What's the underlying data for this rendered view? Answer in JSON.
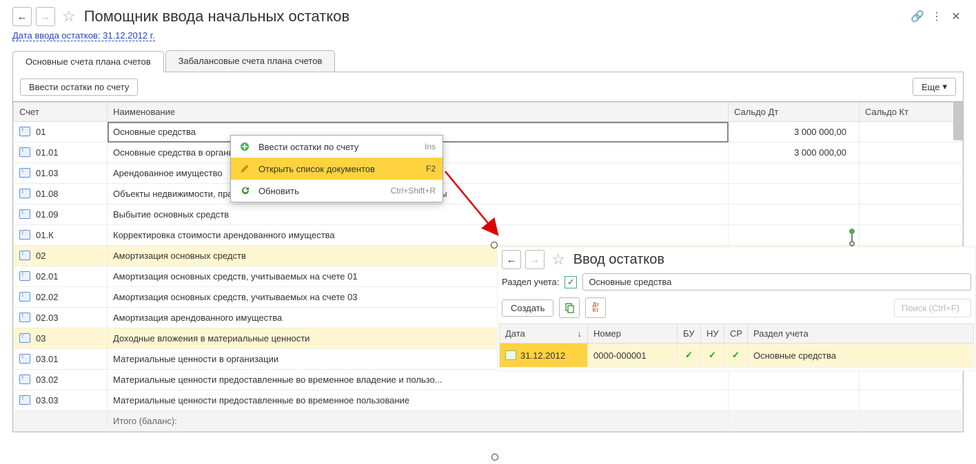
{
  "main": {
    "title": "Помощник ввода начальных остатков",
    "date_link": "Дата ввода остатков: 31.12.2012 г.",
    "tabs": [
      "Основные счета плана счетов",
      "Забалансовые счета плана счетов"
    ],
    "btn_enter": "Ввести остатки по счету",
    "btn_more": "Еще",
    "columns": {
      "c1": "Счет",
      "c2": "Наименование",
      "c3": "Сальдо Дт",
      "c4": "Сальдо Кт"
    },
    "rows": [
      {
        "acc": "01",
        "name": "Основные средства",
        "dt": "3 000 000,00",
        "kt": "",
        "hl": false,
        "sel": true
      },
      {
        "acc": "01.01",
        "name": "Основные средства в организации",
        "dt": "3 000 000,00",
        "kt": "",
        "hl": false
      },
      {
        "acc": "01.03",
        "name": "Арендованное имущество",
        "dt": "",
        "kt": "",
        "hl": false
      },
      {
        "acc": "01.08",
        "name": "Объекты недвижимости, права собственности на которые не зарегистрированы",
        "dt": "",
        "kt": "",
        "hl": false
      },
      {
        "acc": "01.09",
        "name": "Выбытие основных средств",
        "dt": "",
        "kt": "",
        "hl": false
      },
      {
        "acc": "01.К",
        "name": "Корректировка стоимости арендованного имущества",
        "dt": "",
        "kt": "",
        "hl": false
      },
      {
        "acc": "02",
        "name": "Амортизация основных средств",
        "dt": "",
        "kt": "",
        "hl": true
      },
      {
        "acc": "02.01",
        "name": "Амортизация основных средств, учитываемых на счете 01",
        "dt": "",
        "kt": "",
        "hl": false
      },
      {
        "acc": "02.02",
        "name": "Амортизация основных средств, учитываемых на счете 03",
        "dt": "",
        "kt": "",
        "hl": false
      },
      {
        "acc": "02.03",
        "name": "Амортизация арендованного имущества",
        "dt": "",
        "kt": "",
        "hl": false
      },
      {
        "acc": "03",
        "name": "Доходные вложения в материальные ценности",
        "dt": "",
        "kt": "",
        "hl": true
      },
      {
        "acc": "03.01",
        "name": "Материальные ценности в организации",
        "dt": "",
        "kt": "",
        "hl": false
      },
      {
        "acc": "03.02",
        "name": "Материальные ценности предоставленные во временное владение и пользо...",
        "dt": "",
        "kt": "",
        "hl": false
      },
      {
        "acc": "03.03",
        "name": "Материальные ценности предоставленные во временное пользование",
        "dt": "",
        "kt": "",
        "hl": false
      }
    ],
    "footer": "Итого (баланс):"
  },
  "ctx": {
    "items": [
      {
        "icon": "plus",
        "label": "Ввести остатки по счету",
        "sc": "Ins",
        "hi": false
      },
      {
        "icon": "pencil",
        "label": "Открыть список документов",
        "sc": "F2",
        "hi": true
      },
      {
        "icon": "refresh",
        "label": "Обновить",
        "sc": "Ctrl+Shift+R",
        "hi": false
      }
    ]
  },
  "win2": {
    "title": "Ввод остатков",
    "section_label": "Раздел учета:",
    "section_value": "Основные средства",
    "btn_create": "Создать",
    "search_ph": "Поиск (Ctrl+F)",
    "columns": {
      "c1": "Дата",
      "c2": "Номер",
      "c3": "БУ",
      "c4": "НУ",
      "c5": "СР",
      "c6": "Раздел учета"
    },
    "row": {
      "date": "31.12.2012",
      "num": "0000-000001",
      "bu": "✓",
      "nu": "✓",
      "sr": "✓",
      "sect": "Основные средства"
    }
  }
}
